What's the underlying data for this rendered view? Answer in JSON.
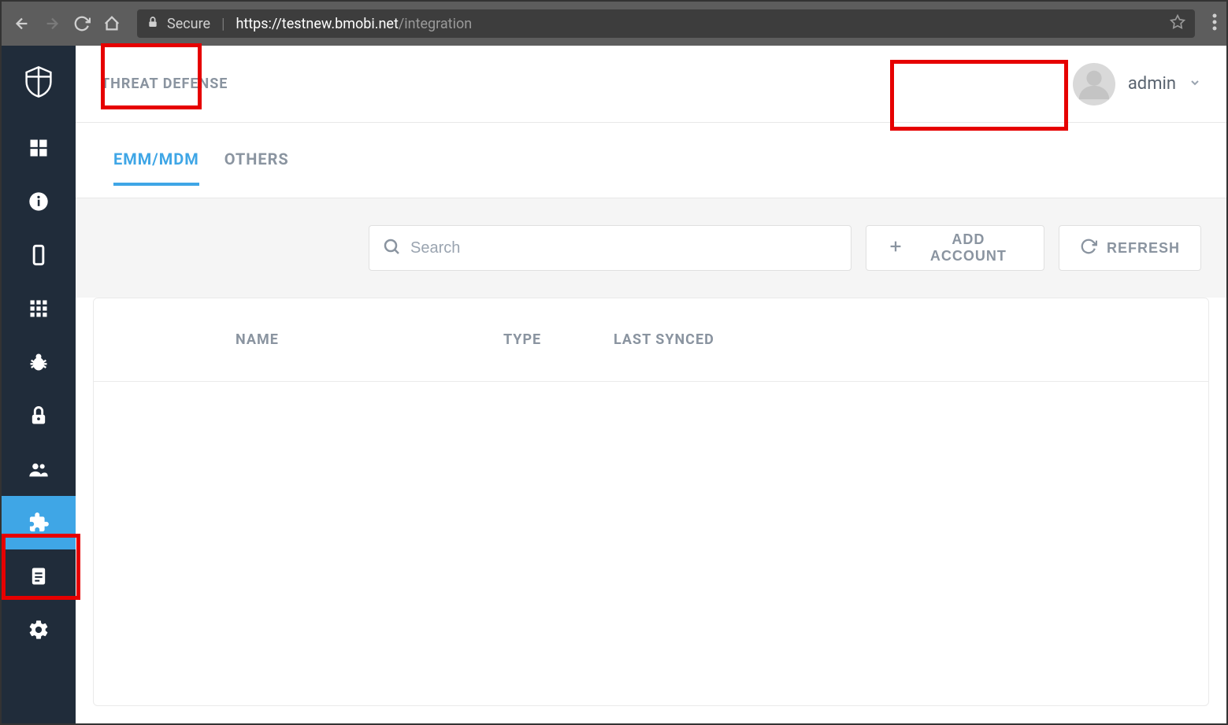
{
  "browser": {
    "secure_label": "Secure",
    "url_host": "https://testnew.bmobi.net",
    "url_path": "/integration"
  },
  "header": {
    "title": "THREAT DEFENSE",
    "username": "admin"
  },
  "tabs": [
    {
      "label": "EMM/MDM",
      "active": true
    },
    {
      "label": "OTHERS",
      "active": false
    }
  ],
  "toolbar": {
    "search_placeholder": "Search",
    "add_account_label": "ADD ACCOUNT",
    "refresh_label": "REFRESH"
  },
  "table": {
    "columns": [
      "NAME",
      "TYPE",
      "LAST SYNCED"
    ],
    "rows": []
  },
  "sidebar": {
    "items": [
      {
        "name": "dashboard",
        "active": false
      },
      {
        "name": "info",
        "active": false
      },
      {
        "name": "device",
        "active": false
      },
      {
        "name": "apps-grid",
        "active": false
      },
      {
        "name": "bug",
        "active": false
      },
      {
        "name": "lock",
        "active": false
      },
      {
        "name": "users",
        "active": false
      },
      {
        "name": "integration",
        "active": true
      },
      {
        "name": "document",
        "active": false
      },
      {
        "name": "settings",
        "active": false
      }
    ]
  }
}
